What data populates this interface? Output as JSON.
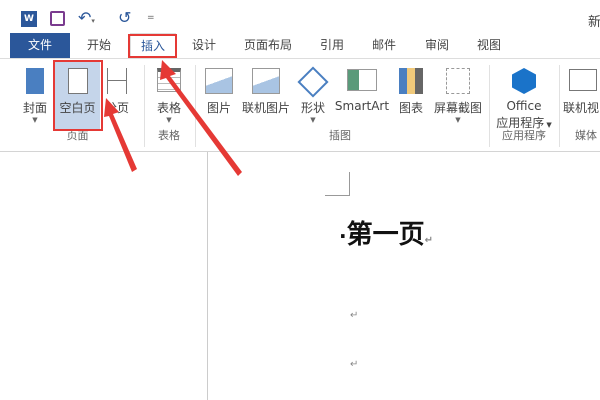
{
  "title_fragment": "新",
  "qat": {
    "word_icon": "word-icon",
    "save_icon": "save-icon",
    "undo_icon": "undo-icon",
    "redo_icon": "redo-icon",
    "customize": "="
  },
  "tabs": [
    "文件",
    "开始",
    "插入",
    "设计",
    "页面布局",
    "引用",
    "邮件",
    "审阅",
    "视图"
  ],
  "ribbon": {
    "groups": [
      "页面",
      "表格",
      "插图",
      "应用程序",
      "媒体"
    ],
    "buttons": {
      "cover": "封面",
      "blank": "空白页",
      "page_break": "分页",
      "table": "表格",
      "picture": "图片",
      "online_picture": "联机图片",
      "shapes": "形状",
      "smartart": "SmartArt",
      "chart": "图表",
      "screenshot": "屏幕截图",
      "office_l1": "Office",
      "office_l2": "应用程序",
      "online_video": "联机视"
    }
  },
  "document": {
    "heading": "第一页",
    "bullet": "·",
    "return_mark": "↵"
  },
  "colors": {
    "accent": "#2b579a",
    "annotation": "#e53935",
    "selected": "#c5d5ea"
  }
}
